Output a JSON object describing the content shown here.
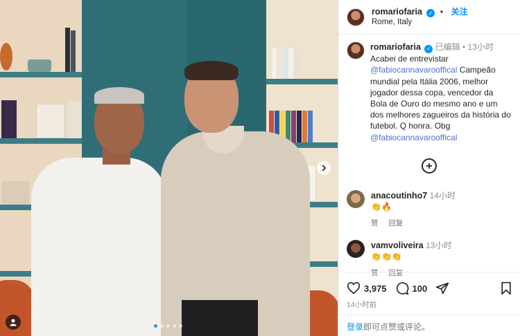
{
  "header": {
    "username": "romariofaria",
    "follow_label": "关注",
    "location": "Rome, Italy",
    "separator": "•"
  },
  "caption": {
    "username": "romariofaria",
    "edited_label": "已编辑",
    "dot": "•",
    "time": "13小时",
    "line1": "Acabei de entrevistar",
    "mention1": "@fabiocannavarooffical",
    "text_main": " Campeão mundial pela Itália 2006, melhor jogador dessa copa, vencedor da Bola de Ouro do mesmo ano e um  dos melhores zagueiros da história do futebol. Q honra. Obg",
    "mention2": "@fabiocannavarooffical"
  },
  "comments": [
    {
      "username": "anacoutinho7",
      "time": "14小时",
      "text": "👏🔥",
      "like_label": "赞",
      "reply_label": "回复"
    },
    {
      "username": "vamvoliveira",
      "time": "13小时",
      "text": "👏👏👏",
      "like_label": "赞",
      "reply_label": "回复"
    }
  ],
  "actions": {
    "likes": "3,975",
    "comments": "100",
    "time_ago": "14小时前"
  },
  "login": {
    "link": "登录",
    "text": "即可点赞或评论。"
  },
  "icons": {
    "carousel_next": "chevron-right-icon",
    "tag": "user-tag-icon",
    "add_comment": "plus-circle-icon",
    "like": "heart-icon",
    "comment": "comment-icon",
    "share": "share-icon",
    "save": "bookmark-icon"
  },
  "colors": {
    "accent": "#0095f6",
    "mention": "#4b6fd6",
    "muted": "#8e8e8e"
  },
  "carousel": {
    "total_slides": 5,
    "active_slide": 1
  }
}
